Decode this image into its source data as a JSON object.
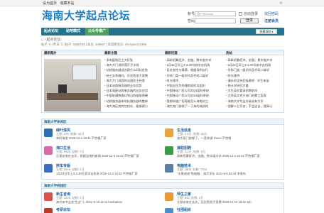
{
  "topbar": {
    "set_home": "设为首页",
    "bookmark": "收藏本站",
    "close": "✕"
  },
  "logo": "海南大学起点论坛",
  "login": {
    "username_label": "帐号",
    "username_placeholder": "用户名/Email",
    "password_label": "密码",
    "auto_login": "自动登录",
    "forgot": "找回密码",
    "login_btn": "登录",
    "register": "注册会员"
  },
  "nav": {
    "items": [
      "起点论坛",
      "贴吧模式",
      "公众号推广"
    ],
    "quick": "快捷导航 ▾"
  },
  "breadcrumb": "⌂ › 起点论坛",
  "stats": "帖子: 0 | 昨日: 1 | 帖子: 1595709 | 会员: 339607 | 欢迎新会员: zhenyan123456",
  "portal": {
    "headers": [
      "最新图片",
      "最新主题",
      "最新回复",
      "热帖"
    ],
    "col1": [
      "多肉配图后工大好处",
      "海大大门说明课开子太线",
      "站群服务器适合建什么网站优势",
      "听三实系微问，历史院发大家教",
      "海大大门说我的法国民主经营",
      "日本站群服务器的业务优势",
      "日本高配站群服务器的业务应用",
      "中国联通数据口到日的维限营硬",
      "站群服务器本地化服务器的整体",
      "海大海区房房包找存，能够建小"
    ],
    "col2": [
      "高新招募经济，金融，数学类大学",
      "1月22日早上4-4.30号游学去机场",
      "征求女性与情感，根据场到自行",
      "学科门类一级学科及代码二级学",
      "时光挑特",
      "中国全民为到通销同时及组织",
      "中国移动广西公司2024届秋季校",
      "中国移动广西公司2024届秋季校",
      "我想知道广招再能怎么海南好三",
      "海大南门前哪了一下来的成结构"
    ],
    "col3": [
      "高新招募经济，金融，数学类大学",
      "1月22日早上4-4.30号游学去机场",
      "学科门类一级学科及代码二级学",
      "时光挑特",
      "漫长的坚持后吸邀吧 - 学生来该",
      "统计学研究大量",
      "学生英文要录前期前吗",
      "工资英文性大海门的教工容表",
      "海南大学专业升级化有大学",
      "他解十七号名，不会这去，就高以"
    ]
  },
  "section1": {
    "title": "海南大学休闲区",
    "forums": [
      {
        "name": "绿叶清风",
        "count": "主题: 475, 帖数: 32万",
        "last": "林时海发 2025-12-2 16:41 不特钢厂家"
      },
      {
        "name": "生活信息",
        "count": "主题: 1.8万, 帖数: 32万",
        "last": "海大宿门前哪了，一直关键 zhuco 不特钢"
      },
      {
        "name": "海口生活",
        "count": "主题: 5625, 帖数: 7万",
        "last": "注意安来在去次，根据当地的新闻 2025-12-2 16:42 不特钢厂家"
      },
      {
        "name": "兼职招聘",
        "count": "主题: 2.1万, 帖数: 6万",
        "last": "高新招募经济，金融，数学类大学 2025-12-2 16:42 不特钢厂家"
      },
      {
        "name": "拼车专版",
        "count": "主题: 2446, 帖数: 1万",
        "last": "1月22日早上4-4.30号游学去机场 2025-12-2 16:43 不特钢厂家"
      },
      {
        "name": "电脑技术",
        "count": "主题: 1605, 帖数: 7912",
        "last": "\"水果成成\"啦电脑... 海大学长 2021-5-5 23:44 李差布"
      }
    ]
  },
  "section2": {
    "title": "海南大学校园区",
    "forums": [
      {
        "name": "新生咨询",
        "count": "主题: 2231, 帖数: 1万",
        "last": "海大本专业发\"生这\"人 2021-9-16 14:11 hunhainan"
      },
      {
        "name": "师生之家",
        "count": "主题: 342, 帖数: 1万",
        "last": "注意安来在去次，历史院发大家教 2025-12-13 18:22 zyh"
      },
      {
        "name": "考研论坛",
        "count": "",
        "last": ""
      },
      {
        "name": "社团组织",
        "count": "",
        "last": ""
      }
    ]
  }
}
